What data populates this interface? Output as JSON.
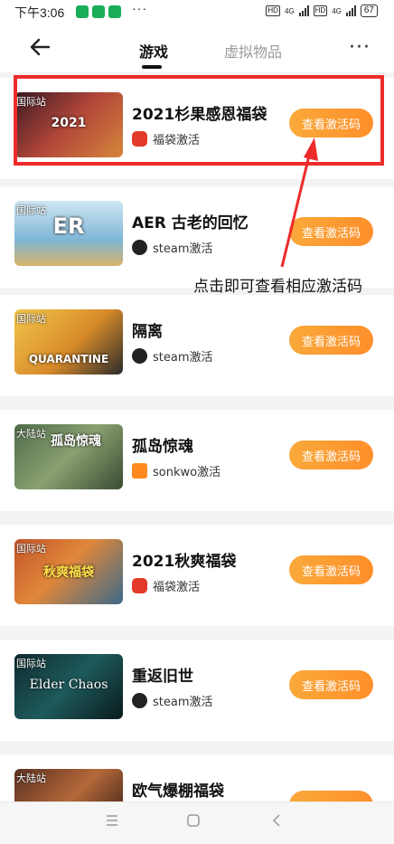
{
  "status_bar": {
    "time": "下午3:06",
    "more": "···",
    "net1": "HD",
    "net1_type": "4G",
    "net2": "HD",
    "net2_type": "4G",
    "battery": "67"
  },
  "nav": {
    "tab_games": "游戏",
    "tab_virtual": "虚拟物品",
    "more": "···"
  },
  "items": [
    {
      "title": "2021杉果感恩福袋",
      "platform": "福袋激活",
      "platform_icon": "lucky-bag-icon",
      "button": "查看激活码",
      "region": "国际站",
      "art": "2021"
    },
    {
      "title": "AER 古老的回忆",
      "platform": "steam激活",
      "platform_icon": "steam-icon",
      "button": "查看激活码",
      "region": "国际站",
      "art": "ER"
    },
    {
      "title": "隔离",
      "platform": "steam激活",
      "platform_icon": "steam-icon",
      "button": "查看激活码",
      "region": "国际站",
      "art": "QUARANTINE"
    },
    {
      "title": "孤岛惊魂",
      "platform": "sonkwo激活",
      "platform_icon": "sonkwo-icon",
      "button": "查看激活码",
      "region": "大陆站",
      "art": "孤岛惊魂"
    },
    {
      "title": "2021秋爽福袋",
      "platform": "福袋激活",
      "platform_icon": "lucky-bag-icon",
      "button": "查看激活码",
      "region": "国际站",
      "art": "秋爽福袋"
    },
    {
      "title": "重返旧世",
      "platform": "steam激活",
      "platform_icon": "steam-icon",
      "button": "查看激活码",
      "region": "国际站",
      "art": "Elder Chaos"
    },
    {
      "title": "欧气爆棚福袋",
      "platform": "",
      "platform_icon": "",
      "button": "",
      "region": "大陆站",
      "art": ""
    }
  ],
  "annotation": {
    "note": "点击即可查看相应激活码"
  },
  "colors": {
    "accent": "#ff9a30",
    "highlight": "#ee2b2b"
  }
}
